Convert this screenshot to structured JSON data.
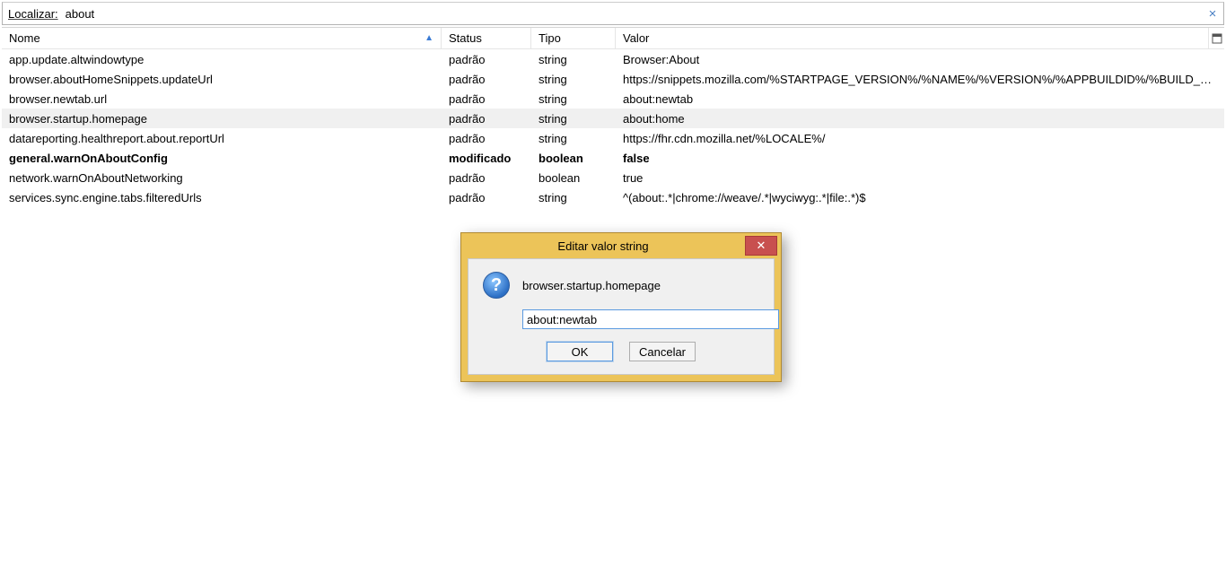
{
  "search": {
    "label": "Localizar:",
    "value": "about"
  },
  "table": {
    "headers": {
      "name": "Nome",
      "status": "Status",
      "type": "Tipo",
      "value": "Valor"
    },
    "rows": [
      {
        "name": "app.update.altwindowtype",
        "status": "padrão",
        "type": "string",
        "value": "Browser:About",
        "modified": false,
        "selected": false
      },
      {
        "name": "browser.aboutHomeSnippets.updateUrl",
        "status": "padrão",
        "type": "string",
        "value": "https://snippets.mozilla.com/%STARTPAGE_VERSION%/%NAME%/%VERSION%/%APPBUILDID%/%BUILD_TARGET%/%LOC...",
        "modified": false,
        "selected": false
      },
      {
        "name": "browser.newtab.url",
        "status": "padrão",
        "type": "string",
        "value": "about:newtab",
        "modified": false,
        "selected": false
      },
      {
        "name": "browser.startup.homepage",
        "status": "padrão",
        "type": "string",
        "value": "about:home",
        "modified": false,
        "selected": true
      },
      {
        "name": "datareporting.healthreport.about.reportUrl",
        "status": "padrão",
        "type": "string",
        "value": "https://fhr.cdn.mozilla.net/%LOCALE%/",
        "modified": false,
        "selected": false
      },
      {
        "name": "general.warnOnAboutConfig",
        "status": "modificado",
        "type": "boolean",
        "value": "false",
        "modified": true,
        "selected": false
      },
      {
        "name": "network.warnOnAboutNetworking",
        "status": "padrão",
        "type": "boolean",
        "value": "true",
        "modified": false,
        "selected": false
      },
      {
        "name": "services.sync.engine.tabs.filteredUrls",
        "status": "padrão",
        "type": "string",
        "value": "^(about:.*|chrome://weave/.*|wyciwyg:.*|file:.*)$",
        "modified": false,
        "selected": false
      }
    ]
  },
  "dialog": {
    "title": "Editar valor string",
    "pref_name": "browser.startup.homepage",
    "input_value": "about:newtab",
    "ok": "OK",
    "cancel": "Cancelar"
  }
}
